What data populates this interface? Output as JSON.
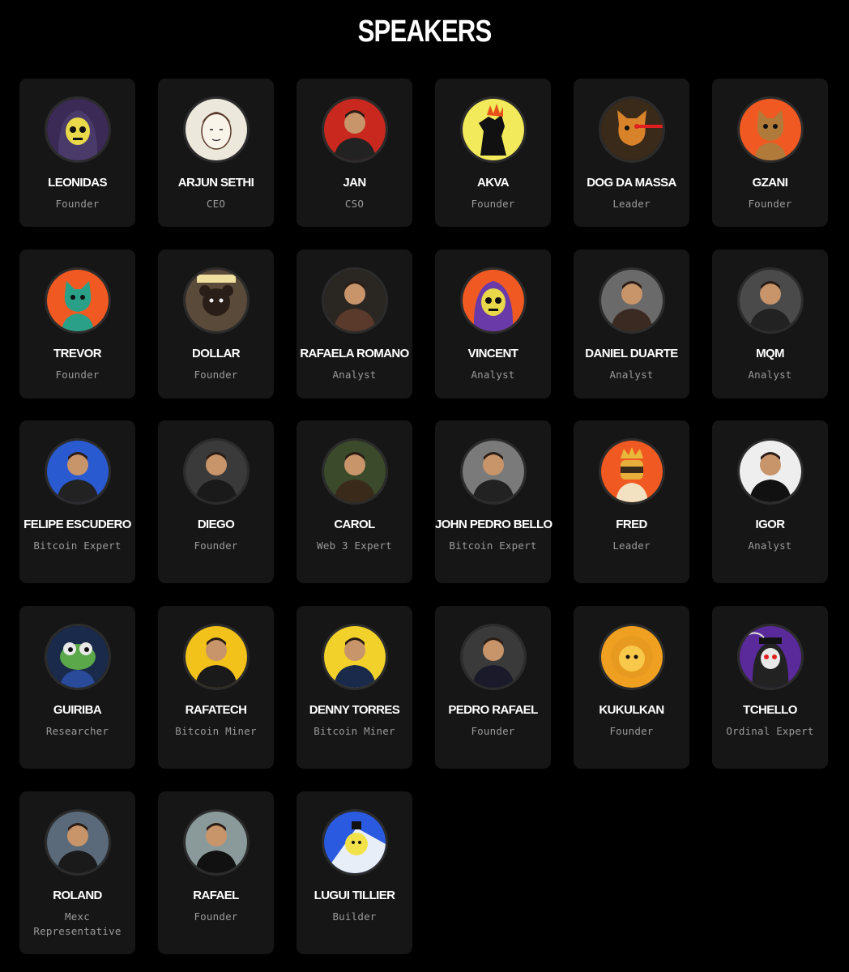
{
  "page": {
    "title": "SPEAKERS"
  },
  "speakers": [
    {
      "name": "LEONIDAS",
      "role": "Founder",
      "avatar_icon": "skull-avatar-icon",
      "bg": "#3a2a55",
      "fg": "#e8d84a"
    },
    {
      "name": "ARJUN SETHI",
      "role": "CEO",
      "avatar_icon": "sketch-face-avatar-icon",
      "bg": "#ece8dc",
      "fg": "#5a3a2a"
    },
    {
      "name": "JAN",
      "role": "CSO",
      "avatar_icon": "person-avatar-icon",
      "bg": "#c8281e",
      "fg": "#222222"
    },
    {
      "name": "AKVA",
      "role": "Founder",
      "avatar_icon": "monster-avatar-icon",
      "bg": "#f2ea5a",
      "fg": "#111111"
    },
    {
      "name": "DOG DA MASSA",
      "role": "Leader",
      "avatar_icon": "dog-avatar-icon",
      "bg": "#3a2a1a",
      "fg": "#d8822a"
    },
    {
      "name": "GZANI",
      "role": "Founder",
      "avatar_icon": "cat-avatar-icon",
      "bg": "#f05a22",
      "fg": "#b07a3a"
    },
    {
      "name": "TREVOR",
      "role": "Founder",
      "avatar_icon": "cat-avatar-icon",
      "bg": "#f05a22",
      "fg": "#2aa088"
    },
    {
      "name": "DOLLAR",
      "role": "Founder",
      "avatar_icon": "bear-avatar-icon",
      "bg": "#5a4a3a",
      "fg": "#2a1f18"
    },
    {
      "name": "RAFAELA ROMANO",
      "role": "Analyst",
      "avatar_icon": "person-avatar-icon",
      "bg": "#2a2622",
      "fg": "#5a3a2a"
    },
    {
      "name": "VINCENT",
      "role": "Analyst",
      "avatar_icon": "hooded-skull-avatar-icon",
      "bg": "#f05a22",
      "fg": "#6a3aa8"
    },
    {
      "name": "DANIEL DUARTE",
      "role": "Analyst",
      "avatar_icon": "person-avatar-icon",
      "bg": "#6a6a6a",
      "fg": "#3a2a22"
    },
    {
      "name": "MQM",
      "role": "Analyst",
      "avatar_icon": "person-avatar-icon",
      "bg": "#4a4a4a",
      "fg": "#222222"
    },
    {
      "name": "FELIPE ESCUDERO",
      "role": "Bitcoin Expert",
      "avatar_icon": "person-avatar-icon",
      "bg": "#2a5ad0",
      "fg": "#222222"
    },
    {
      "name": "DIEGO",
      "role": "Founder",
      "avatar_icon": "person-avatar-icon",
      "bg": "#3a3a3a",
      "fg": "#1a1a1a"
    },
    {
      "name": "CAROL",
      "role": "Web 3 Expert",
      "avatar_icon": "person-avatar-icon",
      "bg": "#3a4a2a",
      "fg": "#3a2a1a"
    },
    {
      "name": "JOHN PEDRO BELLO",
      "role": "Bitcoin Expert",
      "avatar_icon": "person-avatar-icon",
      "bg": "#7a7a7a",
      "fg": "#222222"
    },
    {
      "name": "FRED",
      "role": "Leader",
      "avatar_icon": "crowned-ninja-avatar-icon",
      "bg": "#f05a22",
      "fg": "#e8b83a"
    },
    {
      "name": "IGOR",
      "role": "Analyst",
      "avatar_icon": "person-avatar-icon",
      "bg": "#eeeeee",
      "fg": "#111111"
    },
    {
      "name": "GUIRIBA",
      "role": "Researcher",
      "avatar_icon": "frog-avatar-icon",
      "bg": "#1a2a4a",
      "fg": "#5aa84a"
    },
    {
      "name": "RAFATECH",
      "role": "Bitcoin Miner",
      "avatar_icon": "person-avatar-icon",
      "bg": "#f2c21a",
      "fg": "#1a1a1a"
    },
    {
      "name": "DENNY TORRES",
      "role": "Bitcoin Miner",
      "avatar_icon": "person-avatar-icon",
      "bg": "#f2d22a",
      "fg": "#1a2a4a"
    },
    {
      "name": "PEDRO RAFAEL",
      "role": "Founder",
      "avatar_icon": "person-avatar-icon",
      "bg": "#3a3a3a",
      "fg": "#1a1a2a"
    },
    {
      "name": "KUKULKAN",
      "role": "Founder",
      "avatar_icon": "lion-avatar-icon",
      "bg": "#f0a020",
      "fg": "#f8c84a"
    },
    {
      "name": "TCHELLO",
      "role": "Ordinal Expert",
      "avatar_icon": "reaper-avatar-icon",
      "bg": "#5a2a9a",
      "fg": "#222222"
    },
    {
      "name": "ROLAND",
      "role": "Mexc Representative",
      "avatar_icon": "person-avatar-icon",
      "bg": "#5a6a7a",
      "fg": "#1a1a1a"
    },
    {
      "name": "RAFAEL",
      "role": "Founder",
      "avatar_icon": "person-avatar-icon",
      "bg": "#8a9a9a",
      "fg": "#111111"
    },
    {
      "name": "LUGUI TILLIER",
      "role": "Builder",
      "avatar_icon": "cartoon-avatar-icon",
      "bg": "#2a5ae0",
      "fg": "#f2e24a"
    }
  ]
}
